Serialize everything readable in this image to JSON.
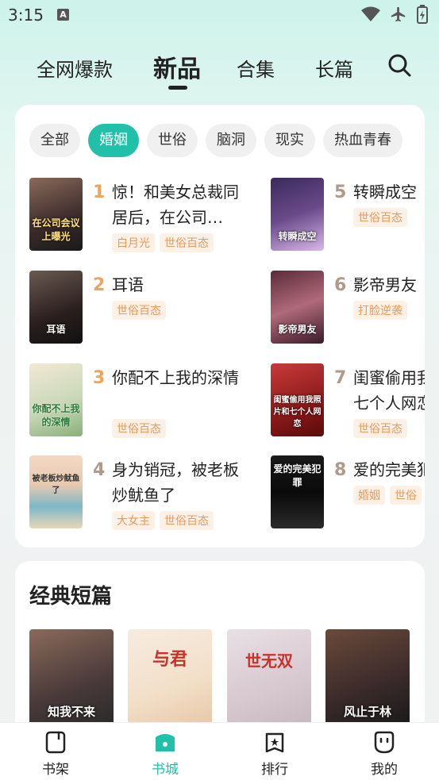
{
  "status_bar": {
    "time": "3:15",
    "a_badge": "A"
  },
  "top_tabs": {
    "items": [
      {
        "label": "全网爆款"
      },
      {
        "label": "新品"
      },
      {
        "label": "合集"
      },
      {
        "label": "长篇"
      }
    ],
    "active": "新品"
  },
  "chips": [
    "全部",
    "婚姻",
    "世俗",
    "脑洞",
    "现实",
    "热血青春"
  ],
  "books": [
    {
      "rank": "1",
      "title": "惊！和美女总裁同居后，在公司…",
      "tags": [
        "白月光",
        "世俗百态"
      ],
      "cover_text": "在公司会议上曝光",
      "rank_color": "#f0a35a"
    },
    {
      "rank": "2",
      "title": "耳语",
      "tags": [
        "世俗百态"
      ],
      "cover_text": "耳语",
      "rank_color": "#f0a35a"
    },
    {
      "rank": "3",
      "title": "你配不上我的深情",
      "tags": [
        "世俗百态"
      ],
      "cover_text": "你配不上我的深情",
      "rank_color": "#f0a35a"
    },
    {
      "rank": "4",
      "title": "身为销冠，被老板炒鱿鱼了",
      "tags": [
        "大女主",
        "世俗百态"
      ],
      "cover_text": "被老板炒鱿鱼了",
      "rank_color": "#b09a8a"
    },
    {
      "rank": "5",
      "title": "转瞬成空",
      "tags": [
        "世俗百态"
      ],
      "cover_text": "转瞬成空",
      "rank_color": "#b09a8a"
    },
    {
      "rank": "6",
      "title": "影帝男友",
      "tags": [
        "打脸逆袭"
      ],
      "cover_text": "影帝男友",
      "rank_color": "#b09a8a"
    },
    {
      "rank": "7",
      "title": "闺蜜偷用我照片和七个人网恋",
      "tags": [
        "世俗百态"
      ],
      "cover_text": "闺蜜偷用我照片和七个人网恋",
      "rank_color": "#b09a8a"
    },
    {
      "rank": "8",
      "title": "爱的完美犯罪",
      "tags": [
        "婚姻",
        "世俗"
      ],
      "cover_text": "爱的完美犯罪",
      "rank_color": "#b09a8a"
    }
  ],
  "classic_short": {
    "title": "经典短篇",
    "covers": [
      "知我不来",
      "与君",
      "世无双",
      "风止于林"
    ]
  },
  "bottom_nav": {
    "items": [
      {
        "label": "书架"
      },
      {
        "label": "书城"
      },
      {
        "label": "排行"
      },
      {
        "label": "我的"
      }
    ],
    "active": "书城"
  },
  "colors": {
    "accent": "#20c1a8",
    "tag_bg": "#fdf0e4",
    "tag_text": "#e89a5c"
  }
}
